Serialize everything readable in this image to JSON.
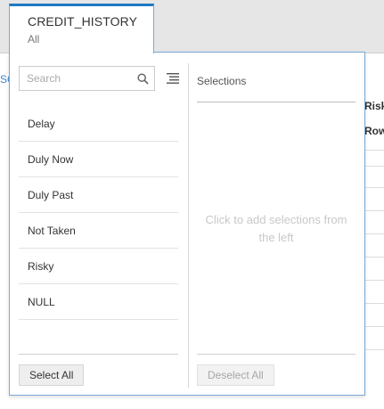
{
  "tab": {
    "title": "CREDIT_HISTORY",
    "subtitle": "All"
  },
  "background": {
    "left_fragment": "SC",
    "col_header_1": "Risk",
    "col_header_2": "Row"
  },
  "search": {
    "placeholder": "Search",
    "value": "",
    "icon": "search-icon"
  },
  "list_menu_icon": "list-menu-icon",
  "items": [
    {
      "label": "Delay"
    },
    {
      "label": "Duly Now"
    },
    {
      "label": "Duly Past"
    },
    {
      "label": "Not Taken"
    },
    {
      "label": "Risky"
    },
    {
      "label": "NULL"
    }
  ],
  "selections": {
    "title": "Selections",
    "empty_text": "Click to add selections from the left"
  },
  "buttons": {
    "select_all": "Select All",
    "deselect_all": "Deselect All"
  },
  "colors": {
    "accent": "#1f7ac4",
    "border": "#7aa9d6"
  }
}
